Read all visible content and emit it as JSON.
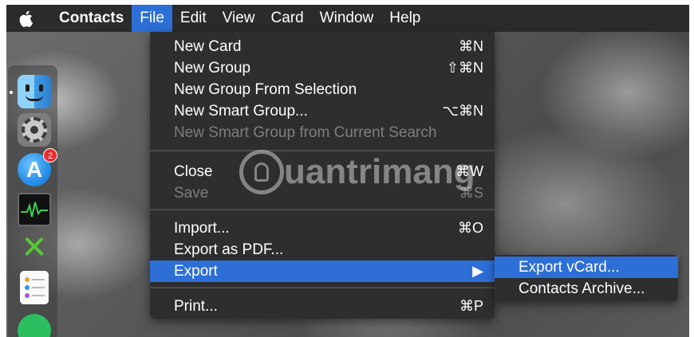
{
  "menubar": {
    "apple_icon": "apple-logo-icon",
    "app_name": "Contacts",
    "items": [
      "File",
      "Edit",
      "View",
      "Card",
      "Window",
      "Help"
    ]
  },
  "file_menu": {
    "new_card": {
      "label": "New Card",
      "shortcut": "⌘N"
    },
    "new_group": {
      "label": "New Group",
      "shortcut": "⇧⌘N"
    },
    "new_group_selection": {
      "label": "New Group From Selection",
      "shortcut": ""
    },
    "new_smart_group": {
      "label": "New Smart Group...",
      "shortcut": "⌥⌘N"
    },
    "new_smart_group_search": {
      "label": "New Smart Group from Current Search",
      "shortcut": ""
    },
    "close": {
      "label": "Close",
      "shortcut": "⌘W"
    },
    "save": {
      "label": "Save",
      "shortcut": "⌘S"
    },
    "import": {
      "label": "Import...",
      "shortcut": "⌘O"
    },
    "export_pdf": {
      "label": "Export as PDF...",
      "shortcut": ""
    },
    "export": {
      "label": "Export",
      "shortcut": "▶"
    },
    "print": {
      "label": "Print...",
      "shortcut": "⌘P"
    }
  },
  "export_submenu": {
    "export_vcard": "Export vCard...",
    "contacts_archive": "Contacts Archive..."
  },
  "dock": {
    "appstore_badge": "2",
    "icons": [
      "finder-icon",
      "system-preferences-icon",
      "app-store-icon",
      "activity-monitor-icon",
      "x-app-icon",
      "reminders-icon",
      "evernote-icon"
    ]
  },
  "watermark": {
    "text": "uantrimang"
  },
  "colors": {
    "menubar_bg": "#2b2b2b",
    "menu_bg": "#2e2e2e",
    "selection": "#2d6fd6",
    "disabled_text": "#7e7e7e"
  }
}
